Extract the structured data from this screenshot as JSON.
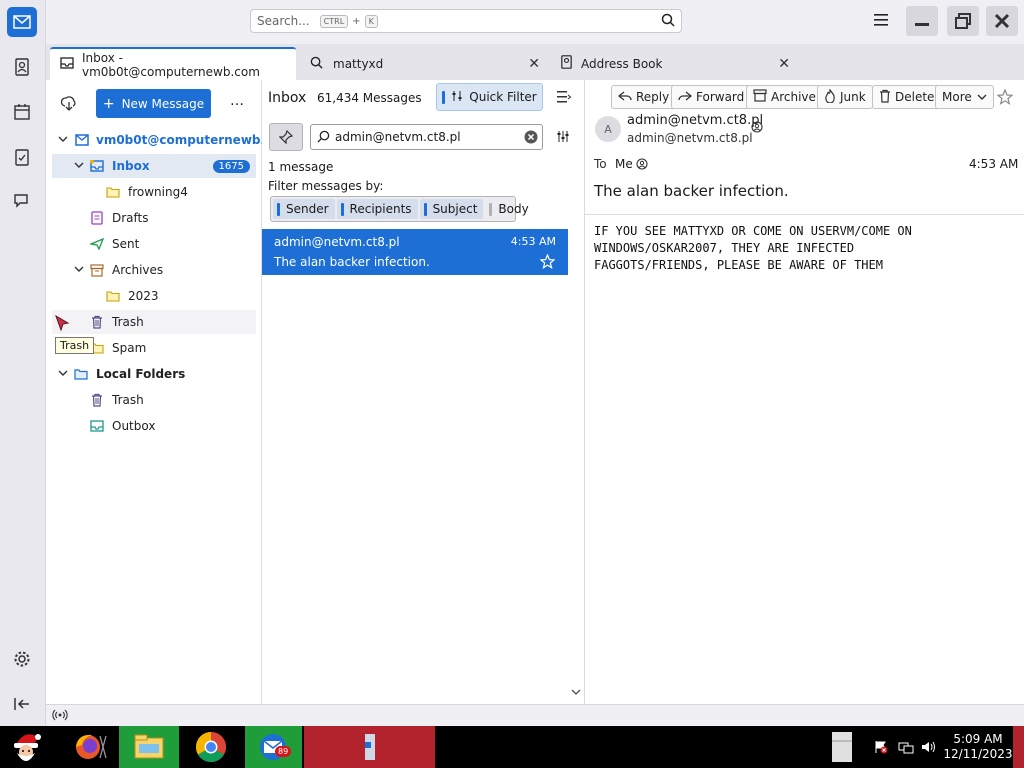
{
  "search": {
    "placeholder": "Search...",
    "shortcut_ctrl": "CTRL",
    "shortcut_plus": "+",
    "shortcut_key": "K"
  },
  "tabs": [
    {
      "label": "Inbox - vm0b0t@computernewb.com"
    },
    {
      "label": "mattyxd"
    },
    {
      "label": "Address Book"
    }
  ],
  "folder_pane": {
    "new_message_label": "New Message",
    "more_label": "…",
    "account": "vm0b0t@computernewb...",
    "folders": [
      {
        "label": "Inbox",
        "count": "1675"
      },
      {
        "label": "frowning4"
      },
      {
        "label": "Drafts"
      },
      {
        "label": "Sent"
      },
      {
        "label": "Archives"
      },
      {
        "label": "2023"
      },
      {
        "label": "Trash"
      },
      {
        "label": "Spam"
      }
    ],
    "local_folders": "Local Folders",
    "local": [
      {
        "label": "Trash"
      },
      {
        "label": "Outbox"
      }
    ],
    "tooltip": "Trash"
  },
  "message_list": {
    "folder_title": "Inbox",
    "message_count": "61,434 Messages",
    "quick_filter_label": "Quick Filter",
    "filter_value": "admin@netvm.ct8.pl",
    "result_count": "1 message",
    "filter_by_label": "Filter messages by:",
    "chips": [
      {
        "label": "Sender"
      },
      {
        "label": "Recipients"
      },
      {
        "label": "Subject"
      },
      {
        "label": "Body"
      }
    ],
    "rows": [
      {
        "sender": "admin@netvm.ct8.pl",
        "time": "4:53 AM",
        "subject": "The alan backer infection."
      }
    ]
  },
  "reader": {
    "buttons": {
      "reply": "Reply",
      "forward": "Forward",
      "archive": "Archive",
      "junk": "Junk",
      "delete": "Delete",
      "more": "More"
    },
    "avatar_letter": "A",
    "from_name": "admin@netvm.ct8.pl",
    "from_email": "admin@netvm.ct8.pl",
    "to_label": "To",
    "to_value": "Me",
    "time": "4:53 AM",
    "subject": "The alan backer infection.",
    "body": "IF YOU SEE MATTYXD OR COME ON USERVM/COME ON\nWINDOWS/OSKAR2007, THEY ARE INFECTED\nFAGGOTS/FRIENDS, PLEASE BE AWARE OF THEM"
  },
  "taskbar": {
    "time": "5:09 AM",
    "date": "12/11/2023",
    "chrome_badge": "89"
  },
  "colors": {
    "accent": "#1d6fd6",
    "selection": "#1d6fd6",
    "taskbar": "#000000"
  }
}
